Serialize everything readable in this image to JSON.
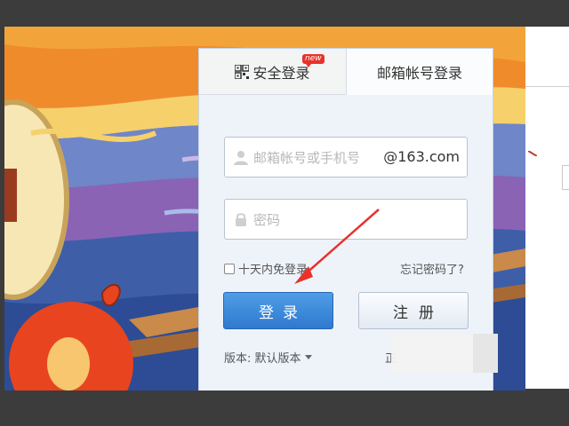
{
  "tabs": {
    "secure_login": "安全登录",
    "new_badge": "new",
    "account_login": "邮箱帐号登录"
  },
  "form": {
    "username_placeholder": "邮箱帐号或手机号",
    "domain_suffix": "@163.com",
    "password_placeholder": "密码",
    "remember_label": "十天内免登录",
    "remember_checked": false,
    "forgot_link": "忘记密码了?"
  },
  "buttons": {
    "login": "登录",
    "register": "注册"
  },
  "footer": {
    "version_label": "版本: 默认版本",
    "right_text": "正"
  },
  "colors": {
    "login_button": "#3a87db",
    "annotation_arrow": "#e8322b"
  },
  "icons": [
    "qr-code-icon",
    "user-icon",
    "lock-icon",
    "chevron-down-icon",
    "arrow-annotation-icon"
  ]
}
